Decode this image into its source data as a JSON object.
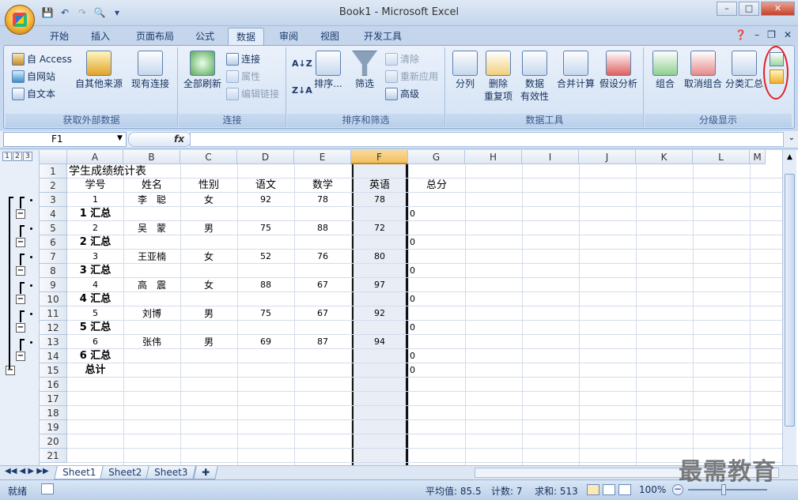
{
  "window": {
    "title": "Book1 - Microsoft Excel"
  },
  "ribbon_tabs": [
    "开始",
    "插入",
    "页面布局",
    "公式",
    "数据",
    "审阅",
    "视图",
    "开发工具"
  ],
  "active_tab": "数据",
  "groups": {
    "external": {
      "label": "获取外部数据",
      "access": "自 Access",
      "web": "自网站",
      "text": "自文本",
      "other": "自其他来源",
      "existing": "现有连接"
    },
    "connections": {
      "label": "连接",
      "refresh": "全部刷新",
      "connections": "连接",
      "properties": "属性",
      "edit_links": "编辑链接"
    },
    "sortfilter": {
      "label": "排序和筛选",
      "sort": "排序...",
      "filter": "筛选",
      "clear": "清除",
      "reapply": "重新应用",
      "advanced": "高级"
    },
    "datatools": {
      "label": "数据工具",
      "split": "分列",
      "remove_dup": "删除\n重复项",
      "validation": "数据\n有效性",
      "consolidate": "合并计算",
      "whatif": "假设分析"
    },
    "outline": {
      "label": "分级显示",
      "group": "组合",
      "ungroup": "取消组合",
      "subtotal": "分类汇总"
    }
  },
  "formula_bar": {
    "name_box": "F1",
    "fx": "fx",
    "formula": ""
  },
  "columns": [
    "A",
    "B",
    "C",
    "D",
    "E",
    "F",
    "G",
    "H",
    "I",
    "J",
    "K",
    "L",
    "M"
  ],
  "selected_column": "F",
  "outline_levels": [
    "1",
    "2",
    "3"
  ],
  "rows": [
    {
      "n": "1",
      "A": "学生成绩统计表"
    },
    {
      "n": "2",
      "A": "学号",
      "B": "姓名",
      "C": "性别",
      "D": "语文",
      "E": "数学",
      "F": "英语",
      "G": "总分"
    },
    {
      "n": "3",
      "A": "1",
      "B": "李　聪",
      "C": "女",
      "D": "92",
      "E": "78",
      "F": "78"
    },
    {
      "n": "4",
      "A": "1 汇总",
      "G": "0"
    },
    {
      "n": "5",
      "A": "2",
      "B": "吴　蒙",
      "C": "男",
      "D": "75",
      "E": "88",
      "F": "72"
    },
    {
      "n": "6",
      "A": "2 汇总",
      "G": "0"
    },
    {
      "n": "7",
      "A": "3",
      "B": "王亚楠",
      "C": "女",
      "D": "52",
      "E": "76",
      "F": "80"
    },
    {
      "n": "8",
      "A": "3 汇总",
      "G": "0"
    },
    {
      "n": "9",
      "A": "4",
      "B": "高　震",
      "C": "女",
      "D": "88",
      "E": "67",
      "F": "97"
    },
    {
      "n": "10",
      "A": "4 汇总",
      "G": "0"
    },
    {
      "n": "11",
      "A": "5",
      "B": "刘博",
      "C": "男",
      "D": "75",
      "E": "67",
      "F": "92"
    },
    {
      "n": "12",
      "A": "5 汇总",
      "G": "0"
    },
    {
      "n": "13",
      "A": "6",
      "B": "张伟",
      "C": "男",
      "D": "69",
      "E": "87",
      "F": "94"
    },
    {
      "n": "14",
      "A": "6 汇总",
      "G": "0"
    },
    {
      "n": "15",
      "A": "总计",
      "G": "0"
    },
    {
      "n": "16"
    },
    {
      "n": "17"
    },
    {
      "n": "18"
    },
    {
      "n": "19"
    },
    {
      "n": "20"
    },
    {
      "n": "21"
    }
  ],
  "sheets": [
    "Sheet1",
    "Sheet2",
    "Sheet3"
  ],
  "active_sheet": "Sheet1",
  "status": {
    "mode": "就绪",
    "average": "平均值: 85.5",
    "count": "计数: 7",
    "sum": "求和: 513",
    "zoom": "100%"
  },
  "watermark": "最需教育"
}
